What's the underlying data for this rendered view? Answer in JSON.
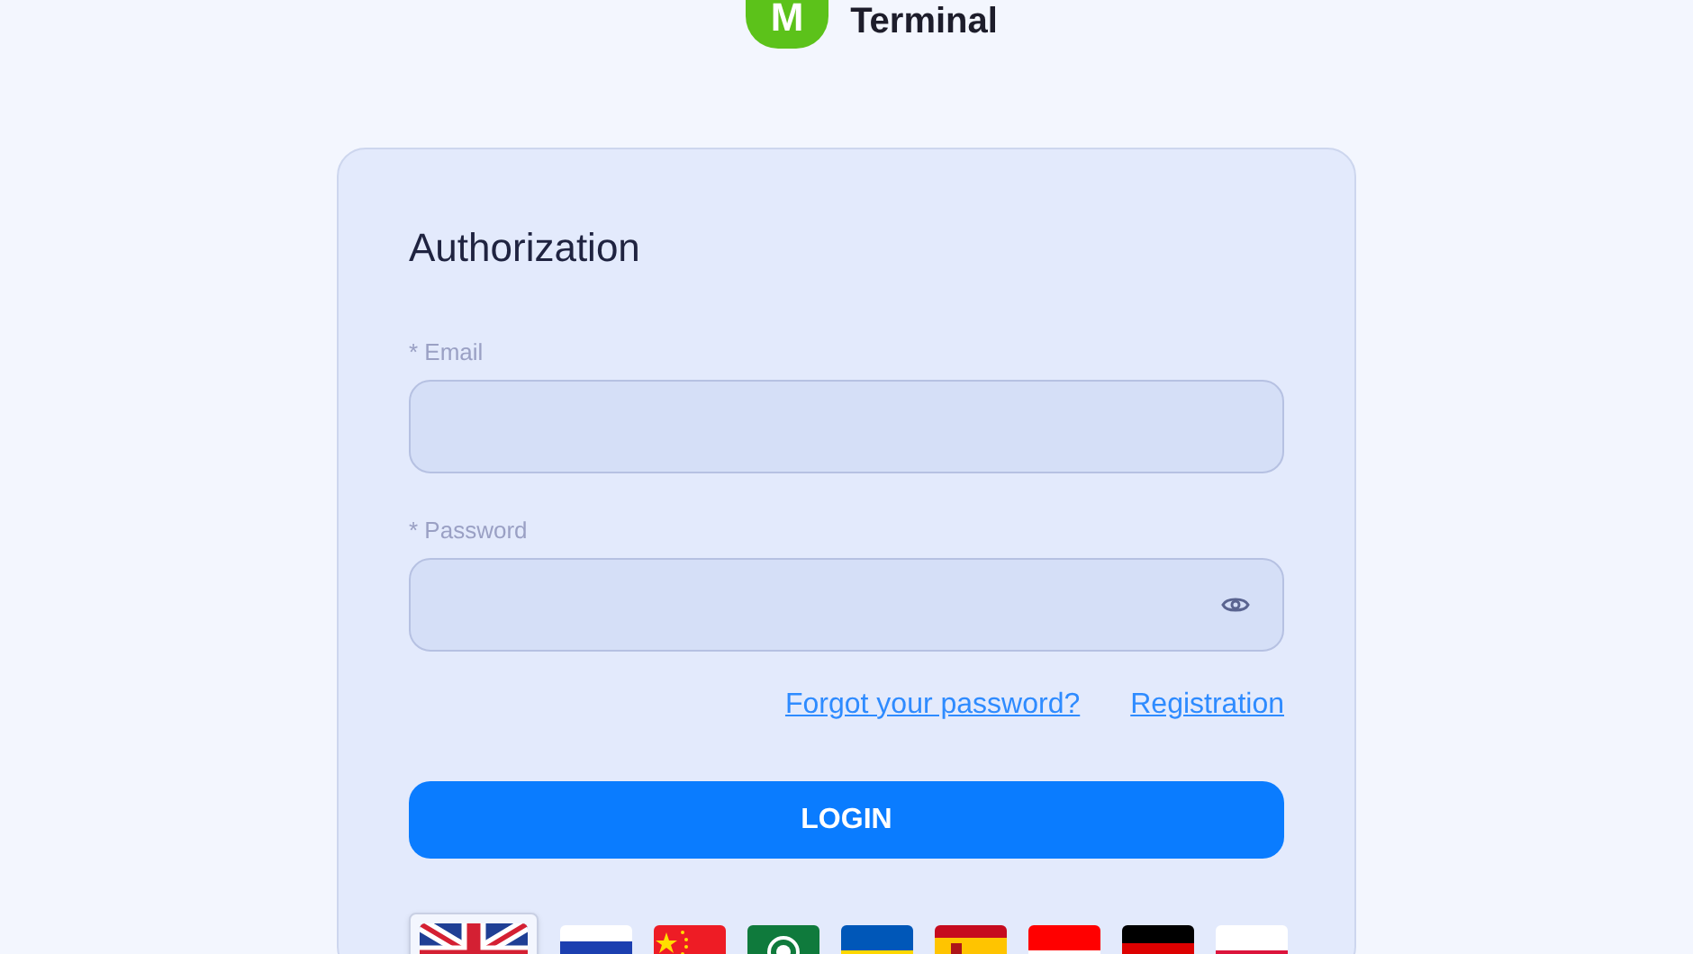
{
  "logo": {
    "letter": "M",
    "text": "Terminal"
  },
  "form": {
    "title": "Authorization",
    "fields": [
      {
        "label": "* Email",
        "kind": "text"
      },
      {
        "label": "* Password",
        "kind": "password"
      }
    ],
    "links": [
      "Forgot your password?",
      "Registration"
    ],
    "button": "LOGIN"
  },
  "languages": [
    {
      "kind": "gb",
      "selected": true
    },
    {
      "kind": "ru",
      "selected": false
    },
    {
      "kind": "cn",
      "selected": false
    },
    {
      "kind": "arab",
      "selected": false
    },
    {
      "kind": "ua",
      "selected": false
    },
    {
      "kind": "es",
      "selected": false
    },
    {
      "kind": "id",
      "selected": false
    },
    {
      "kind": "de",
      "selected": false
    },
    {
      "kind": "pl",
      "selected": false
    }
  ]
}
